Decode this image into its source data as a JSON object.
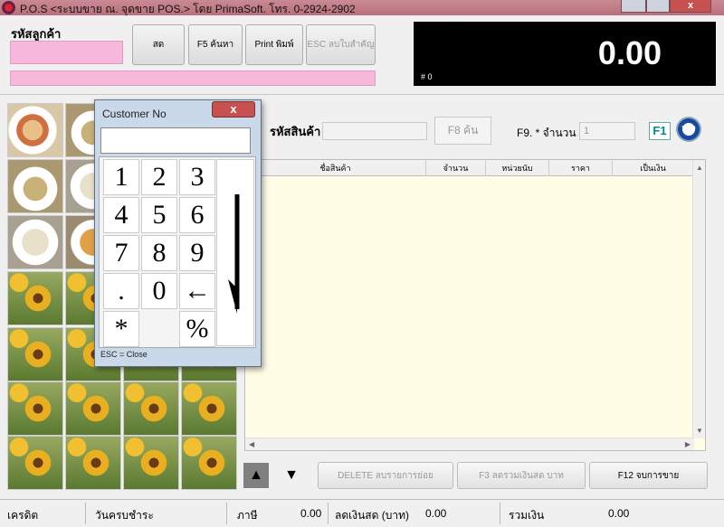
{
  "window": {
    "title": "P.O.S <ระบบขาย ณ. จุดขาย  POS.> โดย PrimaSoft. โทร. 0-2924-2902",
    "close_label": "x"
  },
  "header": {
    "customer_code_label": "รหัสลูกค้า",
    "buttons": {
      "cash": "สด",
      "search": "F5 ค้นหา",
      "print": "Print พิมพ์",
      "esc": "ESC ลบใบสำคัญ"
    },
    "display_amount": "0.00",
    "display_sub": "# 0"
  },
  "product": {
    "code_label": "รหัสสินค้า",
    "search_button": "F8 ค้น",
    "qty_label": "F9. * จำนวน",
    "qty_value": "1",
    "f1_label": "F1",
    "vdo_label": "VDO"
  },
  "table": {
    "columns": [
      "ชื่อสินค้า",
      "จำนวน",
      "หน่วยนับ",
      "ราคา",
      "เป็นเงิน"
    ]
  },
  "actions": {
    "delete": "DELETE ลบรายการย่อย",
    "f3": "F3 ลดรวมเงินสด บาท",
    "f12": "F12 จบการขาย"
  },
  "status": {
    "credit_label": "เครดิต",
    "due_label": "วันครบชำระ",
    "tax_label": "ภาษี",
    "tax_value": "0.00",
    "discount_label": "ลดเงินสด (บาท)",
    "discount_value": "0.00",
    "total_label": "รวมเงิน",
    "total_value": "0.00"
  },
  "keypad": {
    "title": "Customer No",
    "close": "x",
    "keys": [
      "1",
      "2",
      "3",
      "4",
      "5",
      "6",
      "7",
      "8",
      "9",
      ".",
      "0",
      "←",
      "*",
      "%"
    ],
    "status": "ESC = Close"
  }
}
